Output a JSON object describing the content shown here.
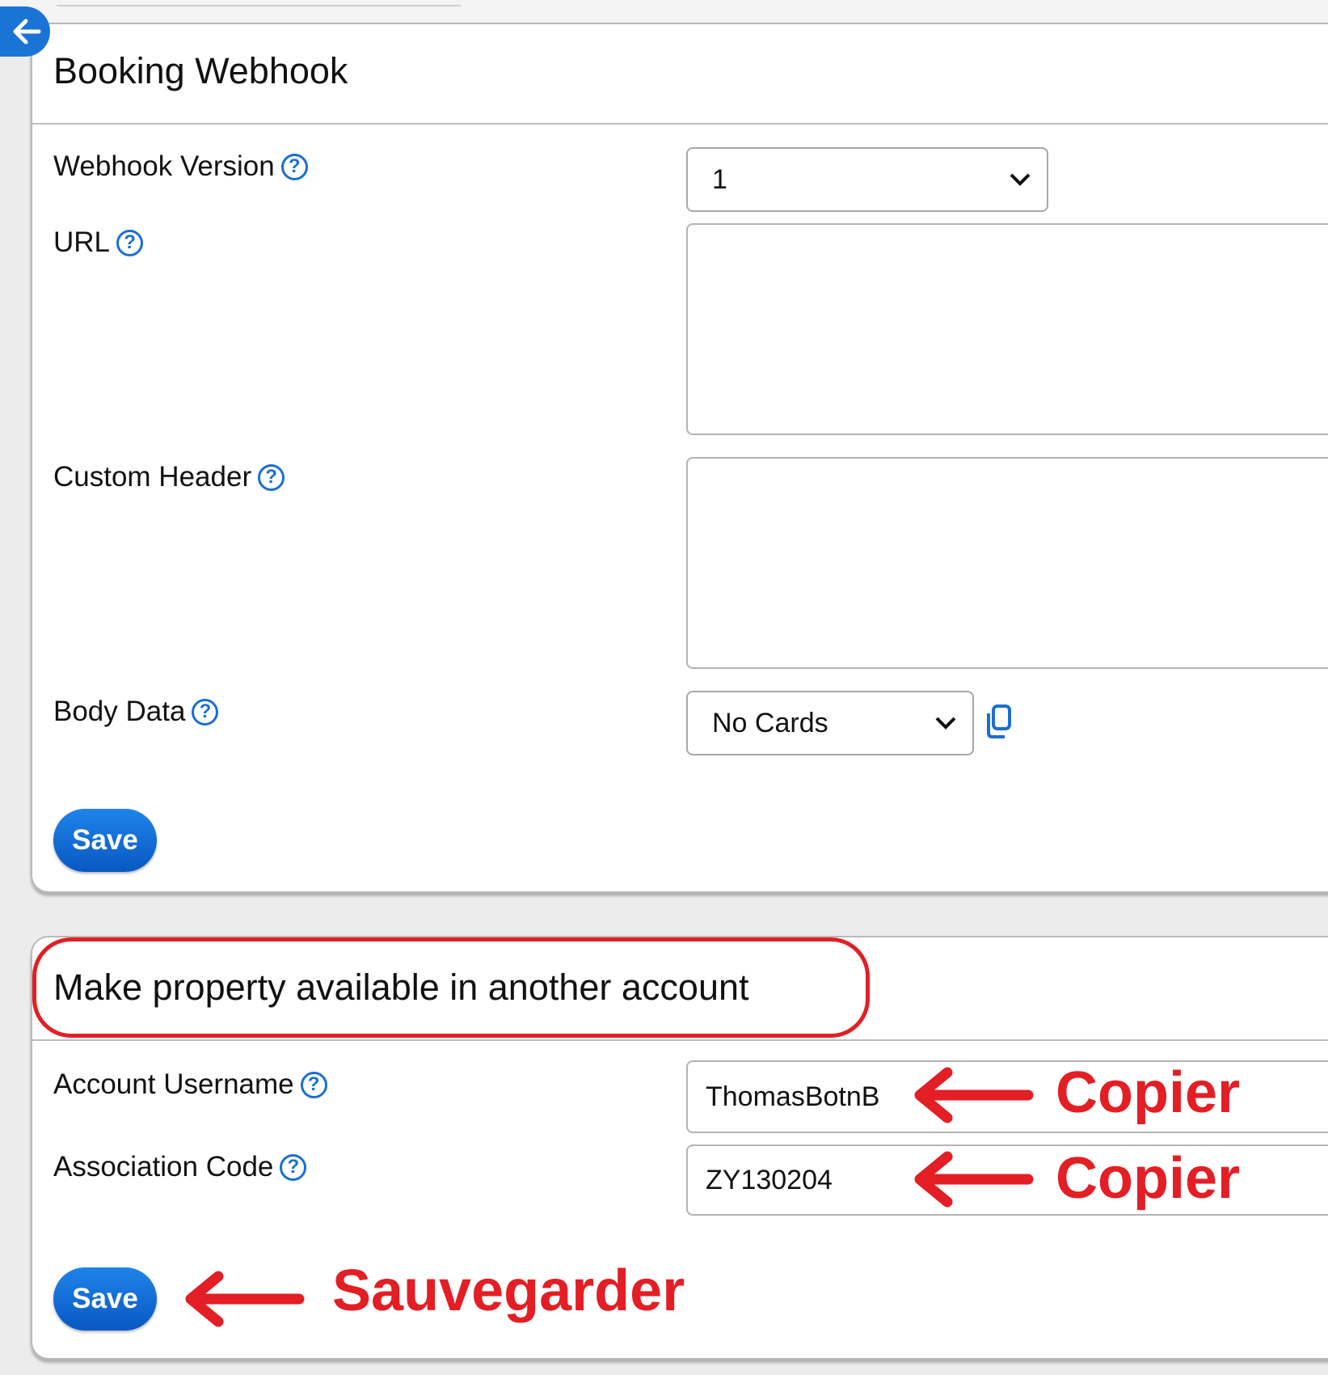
{
  "booking_webhook": {
    "title": "Booking Webhook",
    "fields": {
      "webhook_version_label": "Webhook Version",
      "webhook_version_value": "1",
      "url_label": "URL",
      "url_value": "",
      "custom_header_label": "Custom Header",
      "custom_header_value": "",
      "body_data_label": "Body Data",
      "body_data_value": "No Cards"
    },
    "save_label": "Save"
  },
  "share_property": {
    "title": "Make property available in another account",
    "account_username_label": "Account Username",
    "account_username_value": "ThomasBotnB",
    "association_code_label": "Association Code",
    "association_code_value": "ZY130204",
    "save_label": "Save"
  },
  "annotations": {
    "copy_username": "Copier",
    "copy_code": "Copier",
    "save": "Sauvegarder",
    "color": "#e31e24"
  },
  "colors": {
    "accent": "#1a74d6",
    "annotation": "#e31e24"
  }
}
